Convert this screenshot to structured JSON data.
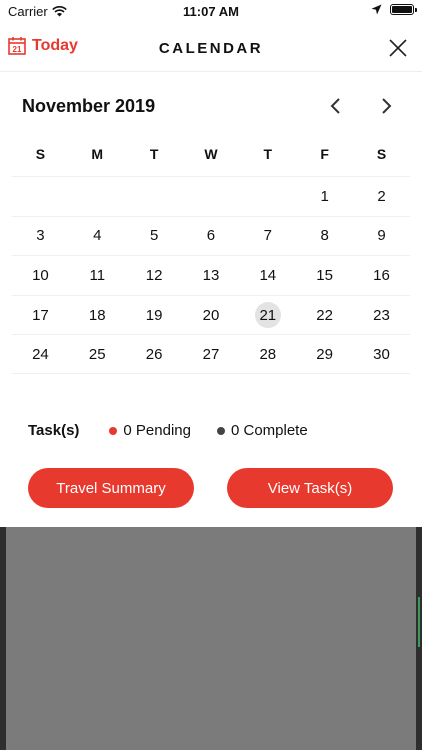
{
  "status": {
    "carrier": "Carrier",
    "time": "11:07 AM"
  },
  "header": {
    "today_label": "Today",
    "today_icon_day": "21",
    "title": "CALENDAR"
  },
  "calendar": {
    "month_title": "November 2019",
    "weekdays": [
      "S",
      "M",
      "T",
      "W",
      "T",
      "F",
      "S"
    ],
    "selected_day": "21",
    "weeks": [
      [
        "",
        "",
        "",
        "",
        "",
        "1",
        "2"
      ],
      [
        "3",
        "4",
        "5",
        "6",
        "7",
        "8",
        "9"
      ],
      [
        "10",
        "11",
        "12",
        "13",
        "14",
        "15",
        "16"
      ],
      [
        "17",
        "18",
        "19",
        "20",
        "21",
        "22",
        "23"
      ],
      [
        "24",
        "25",
        "26",
        "27",
        "28",
        "29",
        "30"
      ]
    ]
  },
  "tasks": {
    "label": "Task(s)",
    "pending": "0 Pending",
    "complete": "0 Complete"
  },
  "buttons": {
    "travel_summary": "Travel Summary",
    "view_tasks": "View Task(s)"
  },
  "colors": {
    "accent": "#e8392e",
    "complete_dot": "#444444",
    "selected_bg": "#e3e3e3"
  }
}
